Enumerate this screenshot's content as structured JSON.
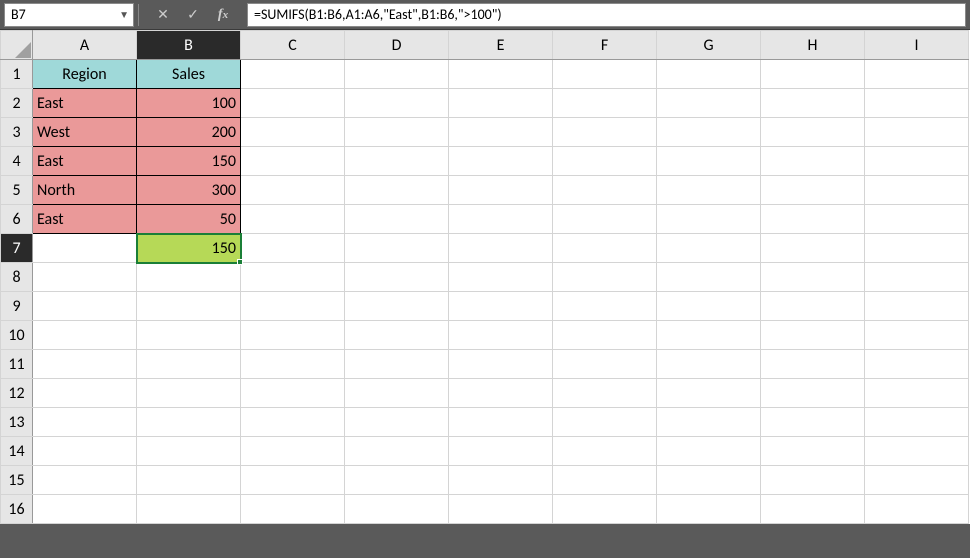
{
  "formula_bar": {
    "cell_ref": "B7",
    "formula": "=SUMIFS(B1:B6,A1:A6,\"East\",B1:B6,\">100\")"
  },
  "columns": [
    "A",
    "B",
    "C",
    "D",
    "E",
    "F",
    "G",
    "H",
    "I"
  ],
  "rows": [
    "1",
    "2",
    "3",
    "4",
    "5",
    "6",
    "7",
    "8",
    "9",
    "10",
    "11",
    "12",
    "13",
    "14",
    "15",
    "16"
  ],
  "selected_col": "B",
  "selected_row": "7",
  "cells": {
    "A1": "Region",
    "B1": "Sales",
    "A2": "East",
    "B2": "100",
    "A3": "West",
    "B3": "200",
    "A4": "East",
    "B4": "150",
    "A5": "North",
    "B5": "300",
    "A6": "East",
    "B6": "50",
    "B7": "150"
  }
}
